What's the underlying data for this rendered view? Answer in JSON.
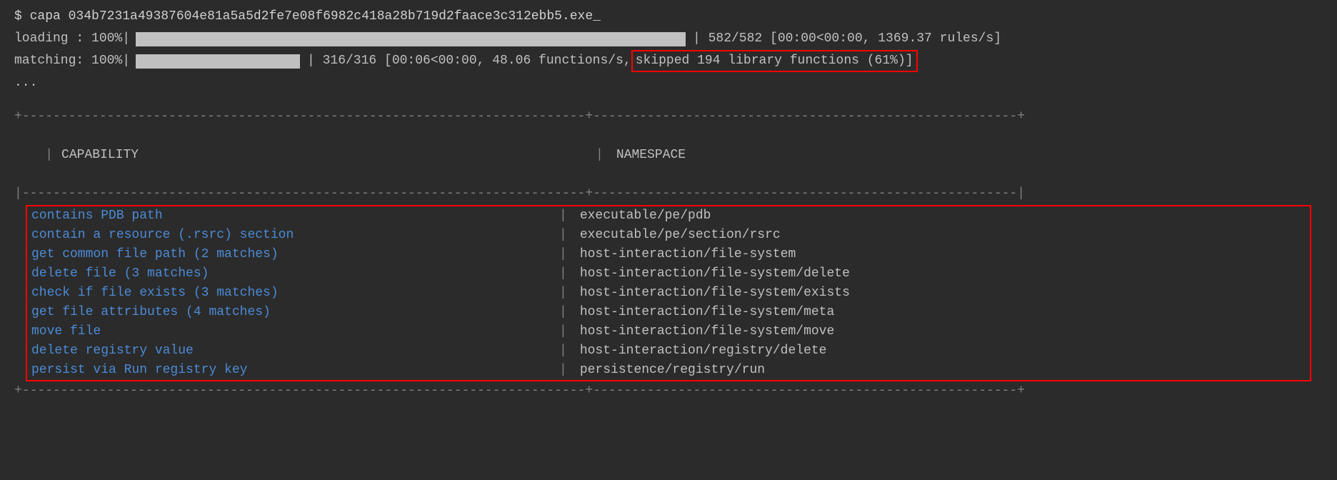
{
  "command": {
    "prompt": "$",
    "text": "capa 034b7231a49387604e81a5a5d2fe7e08f6982c418a28b719d2faace3c312ebb5.exe_"
  },
  "loading": {
    "label": "loading :",
    "percent": "100%",
    "stats": "| 582/582 [00:00<00:00, 1369.37 rules/s]"
  },
  "matching": {
    "label": "matching:",
    "percent": "100%",
    "stats_prefix": "| 316/316 [00:06<00:00, 48.06 functions/s,",
    "skipped": "skipped 194 library functions (61%)]"
  },
  "ellipsis": "...",
  "table": {
    "headers": {
      "capability": "CAPABILITY",
      "namespace": "NAMESPACE"
    },
    "rows": [
      {
        "capability": "contains PDB path",
        "namespace": "executable/pe/pdb"
      },
      {
        "capability": "contain a resource (.rsrc) section",
        "namespace": "executable/pe/section/rsrc"
      },
      {
        "capability": "get common file path (2 matches)",
        "namespace": "host-interaction/file-system"
      },
      {
        "capability": "delete file (3 matches)",
        "namespace": "host-interaction/file-system/delete"
      },
      {
        "capability": "check if file exists (3 matches)",
        "namespace": "host-interaction/file-system/exists"
      },
      {
        "capability": "get file attributes (4 matches)",
        "namespace": "host-interaction/file-system/meta"
      },
      {
        "capability": "move file",
        "namespace": "host-interaction/file-system/move"
      },
      {
        "capability": "delete registry value",
        "namespace": "host-interaction/registry/delete"
      },
      {
        "capability": "persist via Run registry key",
        "namespace": "persistence/registry/run"
      }
    ]
  },
  "borders": {
    "top": "+-------------------------------------------------------------------------+-------------------------------------------------------+",
    "mid": "|-------------------------------------------------------------------------+-------------------------------------------------------|",
    "bot": "+-------------------------------------------------------------------------+-------------------------------------------------------+",
    "pipe": "|"
  }
}
